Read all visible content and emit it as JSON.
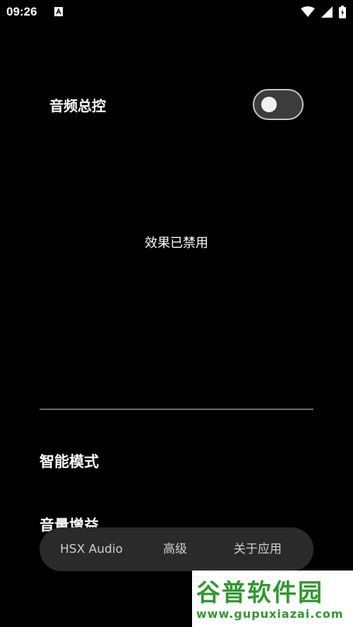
{
  "status_bar": {
    "time": "09:26",
    "icons": [
      "notification-a-icon",
      "wifi-icon",
      "signal-icon",
      "battery-icon"
    ]
  },
  "master_control": {
    "label": "音频总控",
    "toggle_on": false
  },
  "effects_message": "效果已禁用",
  "sections": {
    "smart_mode": "智能模式",
    "volume_gain": "音量增益"
  },
  "nav": {
    "items": [
      {
        "label": "HSX Audio"
      },
      {
        "label": "高级"
      },
      {
        "label": "关于应用"
      }
    ]
  },
  "watermark": {
    "title": "谷普软件园",
    "url": "www.gupuxiazai.com"
  },
  "colors": {
    "background": "#000000",
    "watermark_green": "#2e9a2e"
  }
}
